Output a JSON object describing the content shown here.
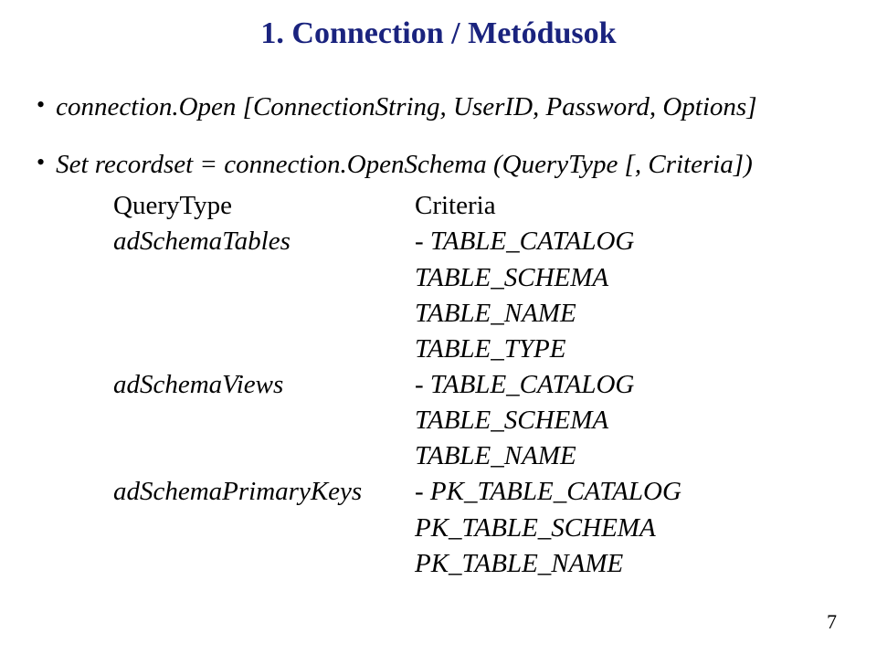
{
  "title": "1. Connection / Metódusok",
  "bullets": {
    "b1": "connection.Open [ConnectionString, UserID, Password, Options]",
    "b2": "Set recordset = connection.OpenSchema (QueryType [, Criteria])"
  },
  "table": {
    "header": {
      "left": "QueryType",
      "right": "Criteria"
    },
    "rows": [
      {
        "left": "adSchemaTables",
        "right": "- TABLE_CATALOG"
      },
      {
        "left": "",
        "right": "TABLE_SCHEMA"
      },
      {
        "left": "",
        "right": "TABLE_NAME"
      },
      {
        "left": "",
        "right": "TABLE_TYPE"
      },
      {
        "left": "adSchemaViews",
        "right": "- TABLE_CATALOG"
      },
      {
        "left": "",
        "right": "TABLE_SCHEMA"
      },
      {
        "left": "",
        "right": "TABLE_NAME"
      },
      {
        "left": "adSchemaPrimaryKeys",
        "right": "- PK_TABLE_CATALOG"
      },
      {
        "left": "",
        "right": "PK_TABLE_SCHEMA"
      },
      {
        "left": "",
        "right": "PK_TABLE_NAME"
      }
    ]
  },
  "page_number": "7"
}
